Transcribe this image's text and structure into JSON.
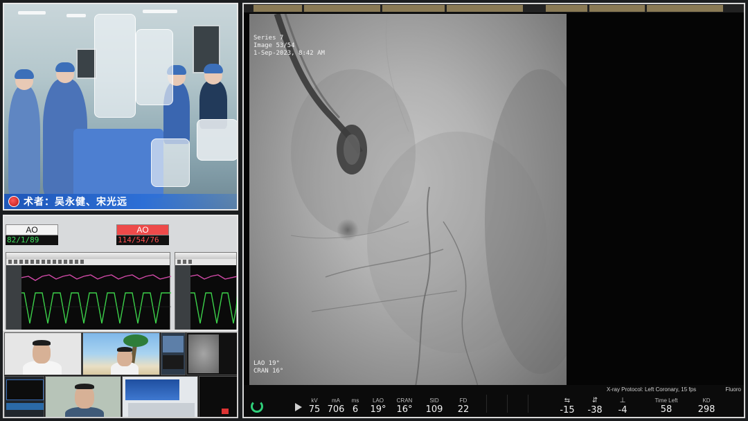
{
  "or_camera": {
    "surgeon_caption": "术者：吴永健、宋光远"
  },
  "monitor": {
    "left": {
      "label": "AO",
      "value": "82/1/89"
    },
    "right": {
      "label": "AO",
      "value": "114/54/76"
    }
  },
  "video_tiles": {
    "labels": [
      "",
      "",
      "",
      "",
      "",
      "",
      ""
    ]
  },
  "fluoro": {
    "overlay_top": [
      "Series 7",
      "Image 53/54",
      "1-Sep-2023, 8:42 AM"
    ],
    "overlay_bottom": [
      "LAO 19°",
      "CRAN 16°"
    ],
    "protocol": "X-ray Protocol: Left Coronary, 15 fps",
    "protocol_right": "Fluoro",
    "params": [
      {
        "label": "kV",
        "value": "75"
      },
      {
        "label": "mA",
        "value": "706"
      },
      {
        "label": "ms",
        "value": "6"
      },
      {
        "label": "LAO",
        "value": "19°"
      },
      {
        "label": "CRAN",
        "value": "16°"
      },
      {
        "label": "SID",
        "value": "109"
      },
      {
        "label": "FD",
        "value": "22"
      }
    ],
    "table": [
      {
        "value": "-15"
      },
      {
        "value": "-38"
      },
      {
        "value": "-4"
      }
    ],
    "time_left": {
      "label": "Time Left",
      "value": "58"
    },
    "kd": {
      "label": "KD",
      "value": "298"
    }
  }
}
